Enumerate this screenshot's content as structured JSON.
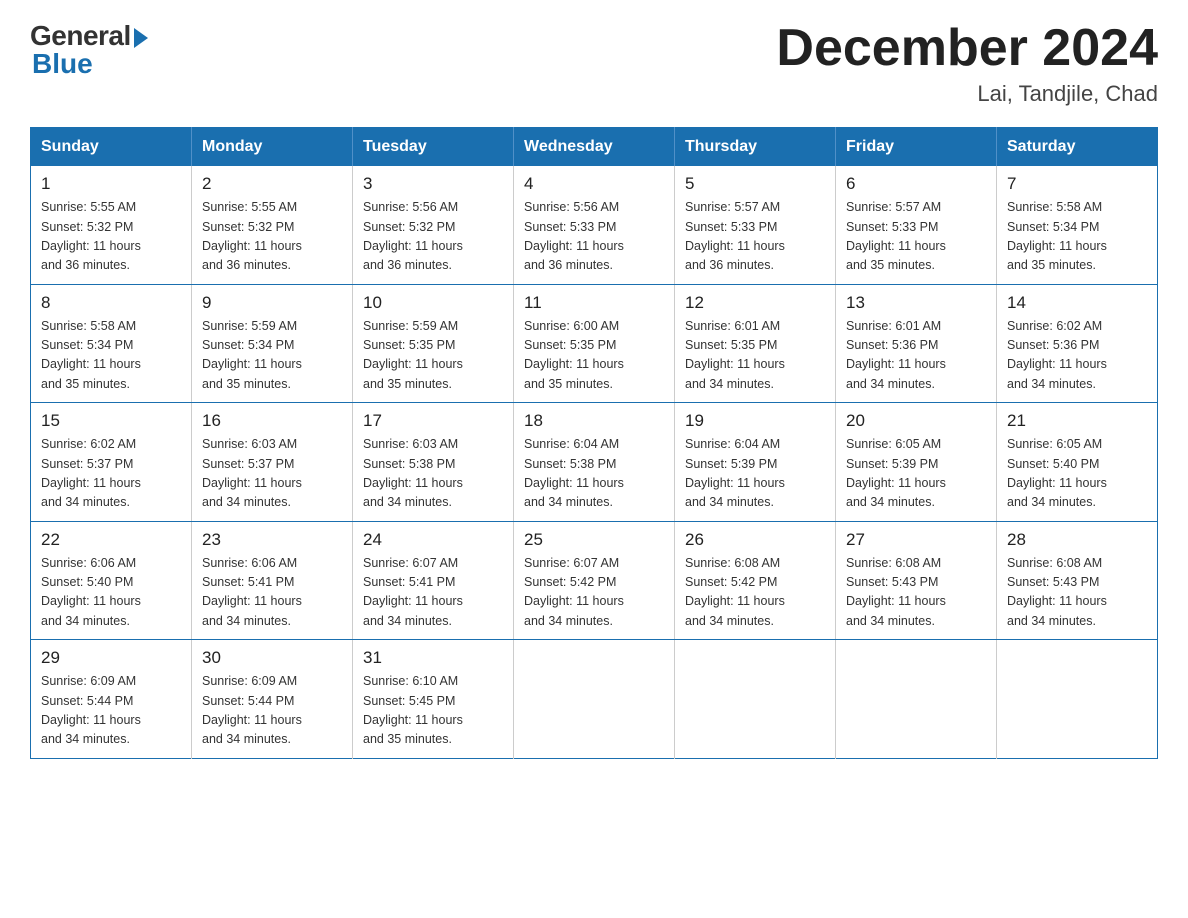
{
  "logo": {
    "general": "General",
    "blue": "Blue"
  },
  "header": {
    "month": "December 2024",
    "location": "Lai, Tandjile, Chad"
  },
  "days_of_week": [
    "Sunday",
    "Monday",
    "Tuesday",
    "Wednesday",
    "Thursday",
    "Friday",
    "Saturday"
  ],
  "weeks": [
    [
      {
        "day": "1",
        "sunrise": "5:55 AM",
        "sunset": "5:32 PM",
        "daylight": "11 hours and 36 minutes."
      },
      {
        "day": "2",
        "sunrise": "5:55 AM",
        "sunset": "5:32 PM",
        "daylight": "11 hours and 36 minutes."
      },
      {
        "day": "3",
        "sunrise": "5:56 AM",
        "sunset": "5:32 PM",
        "daylight": "11 hours and 36 minutes."
      },
      {
        "day": "4",
        "sunrise": "5:56 AM",
        "sunset": "5:33 PM",
        "daylight": "11 hours and 36 minutes."
      },
      {
        "day": "5",
        "sunrise": "5:57 AM",
        "sunset": "5:33 PM",
        "daylight": "11 hours and 36 minutes."
      },
      {
        "day": "6",
        "sunrise": "5:57 AM",
        "sunset": "5:33 PM",
        "daylight": "11 hours and 35 minutes."
      },
      {
        "day": "7",
        "sunrise": "5:58 AM",
        "sunset": "5:34 PM",
        "daylight": "11 hours and 35 minutes."
      }
    ],
    [
      {
        "day": "8",
        "sunrise": "5:58 AM",
        "sunset": "5:34 PM",
        "daylight": "11 hours and 35 minutes."
      },
      {
        "day": "9",
        "sunrise": "5:59 AM",
        "sunset": "5:34 PM",
        "daylight": "11 hours and 35 minutes."
      },
      {
        "day": "10",
        "sunrise": "5:59 AM",
        "sunset": "5:35 PM",
        "daylight": "11 hours and 35 minutes."
      },
      {
        "day": "11",
        "sunrise": "6:00 AM",
        "sunset": "5:35 PM",
        "daylight": "11 hours and 35 minutes."
      },
      {
        "day": "12",
        "sunrise": "6:01 AM",
        "sunset": "5:35 PM",
        "daylight": "11 hours and 34 minutes."
      },
      {
        "day": "13",
        "sunrise": "6:01 AM",
        "sunset": "5:36 PM",
        "daylight": "11 hours and 34 minutes."
      },
      {
        "day": "14",
        "sunrise": "6:02 AM",
        "sunset": "5:36 PM",
        "daylight": "11 hours and 34 minutes."
      }
    ],
    [
      {
        "day": "15",
        "sunrise": "6:02 AM",
        "sunset": "5:37 PM",
        "daylight": "11 hours and 34 minutes."
      },
      {
        "day": "16",
        "sunrise": "6:03 AM",
        "sunset": "5:37 PM",
        "daylight": "11 hours and 34 minutes."
      },
      {
        "day": "17",
        "sunrise": "6:03 AM",
        "sunset": "5:38 PM",
        "daylight": "11 hours and 34 minutes."
      },
      {
        "day": "18",
        "sunrise": "6:04 AM",
        "sunset": "5:38 PM",
        "daylight": "11 hours and 34 minutes."
      },
      {
        "day": "19",
        "sunrise": "6:04 AM",
        "sunset": "5:39 PM",
        "daylight": "11 hours and 34 minutes."
      },
      {
        "day": "20",
        "sunrise": "6:05 AM",
        "sunset": "5:39 PM",
        "daylight": "11 hours and 34 minutes."
      },
      {
        "day": "21",
        "sunrise": "6:05 AM",
        "sunset": "5:40 PM",
        "daylight": "11 hours and 34 minutes."
      }
    ],
    [
      {
        "day": "22",
        "sunrise": "6:06 AM",
        "sunset": "5:40 PM",
        "daylight": "11 hours and 34 minutes."
      },
      {
        "day": "23",
        "sunrise": "6:06 AM",
        "sunset": "5:41 PM",
        "daylight": "11 hours and 34 minutes."
      },
      {
        "day": "24",
        "sunrise": "6:07 AM",
        "sunset": "5:41 PM",
        "daylight": "11 hours and 34 minutes."
      },
      {
        "day": "25",
        "sunrise": "6:07 AM",
        "sunset": "5:42 PM",
        "daylight": "11 hours and 34 minutes."
      },
      {
        "day": "26",
        "sunrise": "6:08 AM",
        "sunset": "5:42 PM",
        "daylight": "11 hours and 34 minutes."
      },
      {
        "day": "27",
        "sunrise": "6:08 AM",
        "sunset": "5:43 PM",
        "daylight": "11 hours and 34 minutes."
      },
      {
        "day": "28",
        "sunrise": "6:08 AM",
        "sunset": "5:43 PM",
        "daylight": "11 hours and 34 minutes."
      }
    ],
    [
      {
        "day": "29",
        "sunrise": "6:09 AM",
        "sunset": "5:44 PM",
        "daylight": "11 hours and 34 minutes."
      },
      {
        "day": "30",
        "sunrise": "6:09 AM",
        "sunset": "5:44 PM",
        "daylight": "11 hours and 34 minutes."
      },
      {
        "day": "31",
        "sunrise": "6:10 AM",
        "sunset": "5:45 PM",
        "daylight": "11 hours and 35 minutes."
      },
      null,
      null,
      null,
      null
    ]
  ],
  "labels": {
    "sunrise": "Sunrise:",
    "sunset": "Sunset:",
    "daylight": "Daylight:"
  }
}
